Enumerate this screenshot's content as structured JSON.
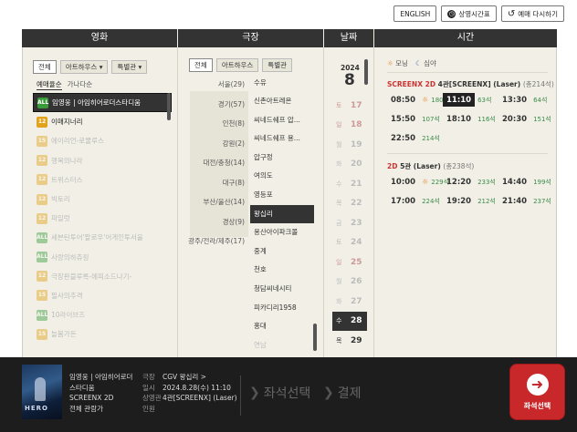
{
  "top_buttons": {
    "english": "ENGLISH",
    "schedule": "상영시간표",
    "reset": "예매 다시하기"
  },
  "headers": {
    "movie": "영화",
    "theater": "극장",
    "date": "날짜",
    "time": "시간"
  },
  "movie": {
    "tabs": [
      "전체",
      "아트하우스 ▾",
      "특별관 ▾"
    ],
    "sort": [
      "예매율순",
      "가나다순"
    ],
    "items": [
      {
        "rating": "ALL",
        "title": "임영웅 | 아임히어로더스타디움",
        "state": "sel"
      },
      {
        "rating": "12",
        "title": "이매지너리",
        "state": "sel2"
      },
      {
        "rating": "15",
        "title": "에이리언-로물루스",
        "state": "dim"
      },
      {
        "rating": "12",
        "title": "행복의나라",
        "state": "dim"
      },
      {
        "rating": "12",
        "title": "트위스터스",
        "state": "dim"
      },
      {
        "rating": "12",
        "title": "빅토리",
        "state": "dim"
      },
      {
        "rating": "12",
        "title": "파일럿",
        "state": "dim"
      },
      {
        "rating": "ALL",
        "title": "세븐틴투어'팔로우'어게인투서울",
        "state": "dim"
      },
      {
        "rating": "ALL",
        "title": "사랑의하츄핑",
        "state": "dim"
      },
      {
        "rating": "12",
        "title": "극장판블루록-에피소드나기-",
        "state": "dim"
      },
      {
        "rating": "15",
        "title": "필사의추격",
        "state": "dim"
      },
      {
        "rating": "ALL",
        "title": "10라이브즈",
        "state": "dim"
      },
      {
        "rating": "15",
        "title": "늘봄가든",
        "state": "dim"
      }
    ]
  },
  "theater": {
    "tabs": [
      "전체",
      "아트하우스",
      "특별관"
    ],
    "regions": [
      "서울(29)",
      "경기(57)",
      "인천(8)",
      "강원(2)",
      "대전/충청(14)",
      "대구(8)",
      "부산/울산(14)",
      "경상(9)",
      "광주/전라/제주(17)"
    ],
    "cinemas": [
      "수유",
      "신촌아트레온",
      "씨네드쉐프 압...",
      "씨네드쉐프 용...",
      "압구정",
      "여의도",
      "영등포",
      "왕십리",
      "용산아이파크몰",
      "중계",
      "천호",
      "청담씨네시티",
      "피카디리1958",
      "홍대",
      "연남",
      "미계"
    ]
  },
  "date": {
    "year": "2024",
    "month": "8",
    "days": [
      {
        "w": "토",
        "d": "17",
        "kind": "sat"
      },
      {
        "w": "일",
        "d": "18",
        "kind": "sun"
      },
      {
        "w": "월",
        "d": "19",
        "kind": "dim"
      },
      {
        "w": "화",
        "d": "20",
        "kind": "dim"
      },
      {
        "w": "수",
        "d": "21",
        "kind": "dim"
      },
      {
        "w": "목",
        "d": "22",
        "kind": "dim"
      },
      {
        "w": "금",
        "d": "23",
        "kind": "dim"
      },
      {
        "w": "토",
        "d": "24",
        "kind": "dim"
      },
      {
        "w": "일",
        "d": "25",
        "kind": "sun"
      },
      {
        "w": "월",
        "d": "26",
        "kind": "dim"
      },
      {
        "w": "화",
        "d": "27",
        "kind": "dim"
      },
      {
        "w": "수",
        "d": "28",
        "kind": "sel"
      },
      {
        "w": "목",
        "d": "29",
        "kind": "lastd"
      }
    ]
  },
  "time": {
    "legend_morning": "모닝",
    "legend_night": "심야",
    "hall1": {
      "prefix": "SCREENX 2D",
      "name": "4관[SCREENX] (Laser)",
      "seats": "(총214석)"
    },
    "hall1_slots": [
      {
        "t": "08:50",
        "sun": true,
        "r": "180석"
      },
      {
        "t": "11:10",
        "sel": true,
        "r": "63석"
      },
      {
        "t": "13:30",
        "r": "64석"
      },
      {
        "t": "15:50",
        "r": "107석"
      },
      {
        "t": "18:10",
        "r": "116석"
      },
      {
        "t": "20:30",
        "r": "151석"
      },
      {
        "t": "22:50",
        "r": "214석"
      }
    ],
    "hall2": {
      "prefix": "2D",
      "name": "5관 (Laser)",
      "seats": "(총238석)"
    },
    "hall2_slots": [
      {
        "t": "10:00",
        "sun": true,
        "r": "229석"
      },
      {
        "t": "12:20",
        "r": "233석"
      },
      {
        "t": "14:40",
        "r": "199석"
      },
      {
        "t": "17:00",
        "r": "224석"
      },
      {
        "t": "19:20",
        "r": "212석"
      },
      {
        "t": "21:40",
        "r": "237석"
      }
    ]
  },
  "bottom": {
    "poster_text": "HERO",
    "movie_line1": "임영웅 | 아임히어로더",
    "movie_line2": "스타디움",
    "movie_format": "SCREENX 2D",
    "movie_rating": "전체 관람가",
    "lbl_theater": "극장",
    "val_theater": "CGV 왕십리 >",
    "lbl_datetime": "일시",
    "val_datetime": "2024.8.28(수) 11:10",
    "lbl_hall": "상영관",
    "val_hall": "4관[SCREENX] (Laser)",
    "lbl_people": "인원",
    "step1": "좌석선택",
    "step2": "결제",
    "seat_button": "좌석선택"
  },
  "colors": {
    "accent": "#c8282a",
    "header": "#333333",
    "panel": "#f2f0e6",
    "remain": "#3a8a4a"
  }
}
